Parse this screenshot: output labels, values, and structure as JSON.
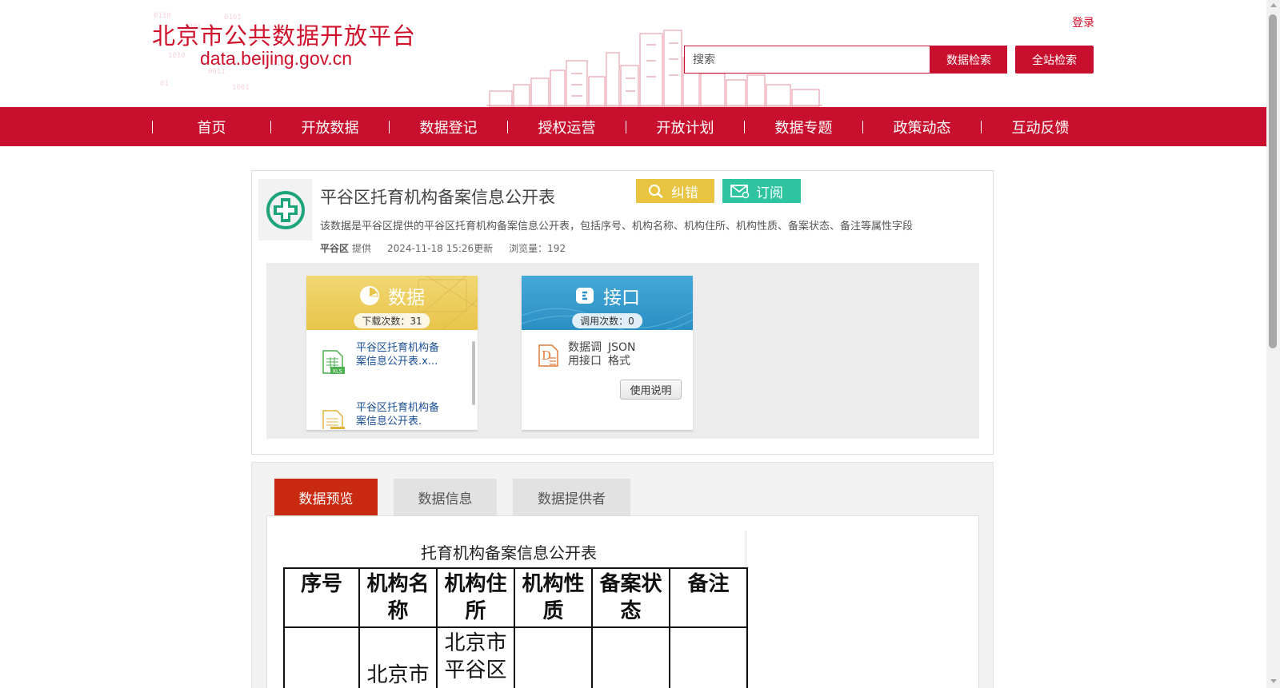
{
  "header": {
    "site_title": "北京市公共数据开放平台",
    "site_domain": "data.beijing.gov.cn",
    "login": "登录",
    "search_placeholder": "搜索",
    "data_search_button": "数据检索",
    "site_search_button": "全站检索"
  },
  "nav": {
    "items": [
      "首页",
      "开放数据",
      "数据登记",
      "授权运营",
      "开放计划",
      "数据专题",
      "政策动态",
      "互动反馈"
    ]
  },
  "dataset": {
    "title": "平谷区托育机构备案信息公开表",
    "correct_button": "纠错",
    "subscribe_button": "订阅",
    "description": "该数据是平谷区提供的平谷区托育机构备案信息公开表，包括序号、机构名称、机构住所、机构性质、备案状态、备注等属性字段",
    "provider": "平谷区",
    "provider_suffix": "提供",
    "updated": "2024-11-18 15:26更新",
    "views": "浏览量：192"
  },
  "data_card": {
    "title": "数据",
    "downloads": "下载次数：31",
    "files": [
      {
        "name": "平谷区托育机构备案信息公开表.x...",
        "type": "XLS"
      },
      {
        "name": "平谷区托育机构备案信息公开表.",
        "type": "CSV"
      }
    ]
  },
  "api_card": {
    "title": "接口",
    "calls": "调用次数：0",
    "item_label": "数据调用接口",
    "item_format": "JSON格式",
    "usage_button": "使用说明"
  },
  "tabs": {
    "preview": "数据预览",
    "info": "数据信息",
    "provider": "数据提供者"
  },
  "preview_doc": {
    "title": "托育机构备案信息公开表",
    "headers": [
      "序号",
      "机构名称",
      "机构住所",
      "机构性质",
      "备案状态",
      "备注"
    ],
    "row1": [
      "",
      "北京市",
      "北京市平谷区",
      "",
      "",
      ""
    ]
  }
}
